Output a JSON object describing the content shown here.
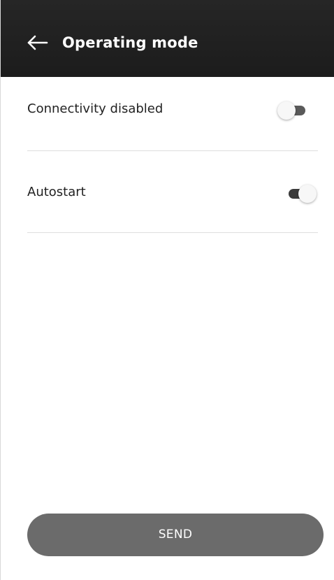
{
  "header": {
    "title": "Operating mode",
    "back_icon": "arrow-left-icon",
    "background": "#222222"
  },
  "settings": [
    {
      "label": "Connectivity disabled",
      "enabled": false
    },
    {
      "label": "Autostart",
      "enabled": true
    }
  ],
  "footer": {
    "send_label": "SEND"
  },
  "colors": {
    "header_bg": "#222222",
    "button_bg": "#6b6b6b",
    "text": "#222222",
    "divider": "#dedede"
  }
}
